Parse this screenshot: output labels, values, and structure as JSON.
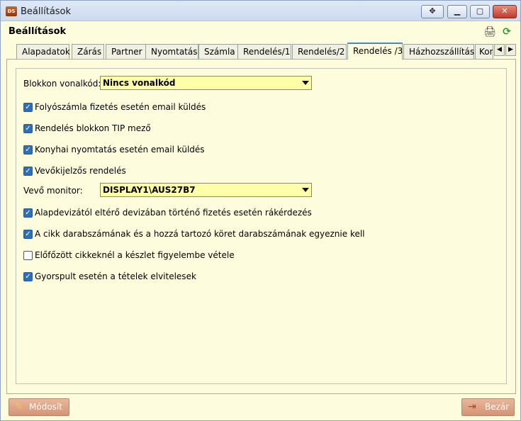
{
  "window": {
    "title": "Beállítások",
    "app_icon_text": "DS"
  },
  "header": {
    "title": "Beállítások"
  },
  "tabs": [
    {
      "label": "Alapadatok"
    },
    {
      "label": "Zárás"
    },
    {
      "label": "Partner"
    },
    {
      "label": "Nyomtatás"
    },
    {
      "label": "Számla"
    },
    {
      "label": "Rendelés/1"
    },
    {
      "label": "Rendelés/2"
    },
    {
      "label": "Rendelés /3"
    },
    {
      "label": "Házhozszállítás"
    },
    {
      "label": "Kon"
    }
  ],
  "active_tab": "Rendelés /3",
  "form": {
    "receipt_barcode_label": "Blokkon vonalkód:",
    "receipt_barcode_value": "Nincs vonalkód",
    "customer_monitor_label": "Vevő monitor:",
    "customer_monitor_value": "DISPLAY1\\AUS27B7",
    "checks": [
      {
        "label": "Folyószámla fizetés esetén email küldés",
        "checked": true
      },
      {
        "label": "Rendelés blokkon TIP mező",
        "checked": true
      },
      {
        "label": "Konyhai nyomtatás esetén email küldés",
        "checked": true
      },
      {
        "label": "Vevőkijelzős rendelés",
        "checked": true
      },
      {
        "label": "Alapdevizától eltérő devizában történő fizetés esetén rákérdezés",
        "checked": true
      },
      {
        "label": "A cikk darabszámának és a hozzá tartozó köret darabszámának egyeznie kell",
        "checked": true
      },
      {
        "label": "Előfőzött cikkeknél a készlet figyelembe vétele",
        "checked": false
      },
      {
        "label": "Gyorspult esetén a tételek elvitelesek",
        "checked": true
      }
    ]
  },
  "footer": {
    "modify_label": "Módosít",
    "close_label": "Bezár"
  },
  "colors": {
    "background": "#fdfdde",
    "combo_background": "#ffffa8",
    "checkbox_checked": "#2f6fb8",
    "footer_button": "#d39476"
  }
}
